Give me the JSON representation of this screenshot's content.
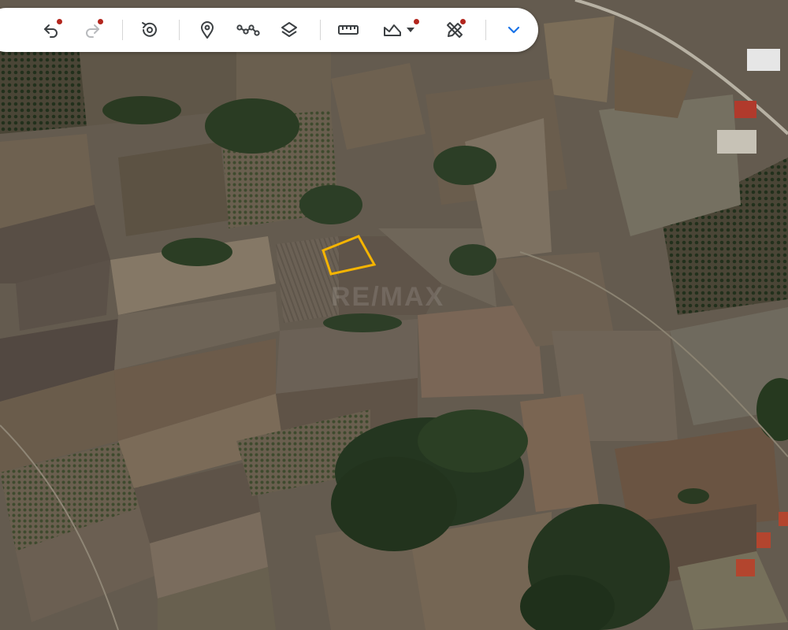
{
  "map": {
    "view": "satellite",
    "selected_parcel_color": "#f5b400",
    "watermark": "RE/MAX"
  },
  "toolbar": {
    "background": "#ffffff",
    "icon_color": "#3c4043",
    "accent_color": "#1a73e8",
    "notification_dot_color": "#b3261e",
    "buttons": [
      {
        "name": "undo",
        "icon": "undo-icon",
        "enabled": true,
        "badge": true
      },
      {
        "name": "redo",
        "icon": "redo-icon",
        "enabled": false,
        "badge": true
      },
      {
        "name": "history",
        "icon": "history-icon",
        "enabled": true,
        "badge": false
      },
      {
        "name": "add-marker",
        "icon": "map-pin-icon",
        "enabled": true,
        "badge": false
      },
      {
        "name": "draw-path",
        "icon": "path-icon",
        "enabled": true,
        "badge": false
      },
      {
        "name": "layers",
        "icon": "layers-icon",
        "enabled": true,
        "badge": false
      },
      {
        "name": "measure",
        "icon": "ruler-icon",
        "enabled": true,
        "badge": false
      },
      {
        "name": "terrain",
        "icon": "terrain-icon",
        "enabled": true,
        "badge": true
      },
      {
        "name": "tools",
        "icon": "pencil-ruler-icon",
        "enabled": true,
        "badge": true
      },
      {
        "name": "expand",
        "icon": "chevron-down-icon",
        "enabled": true,
        "badge": false
      }
    ]
  }
}
